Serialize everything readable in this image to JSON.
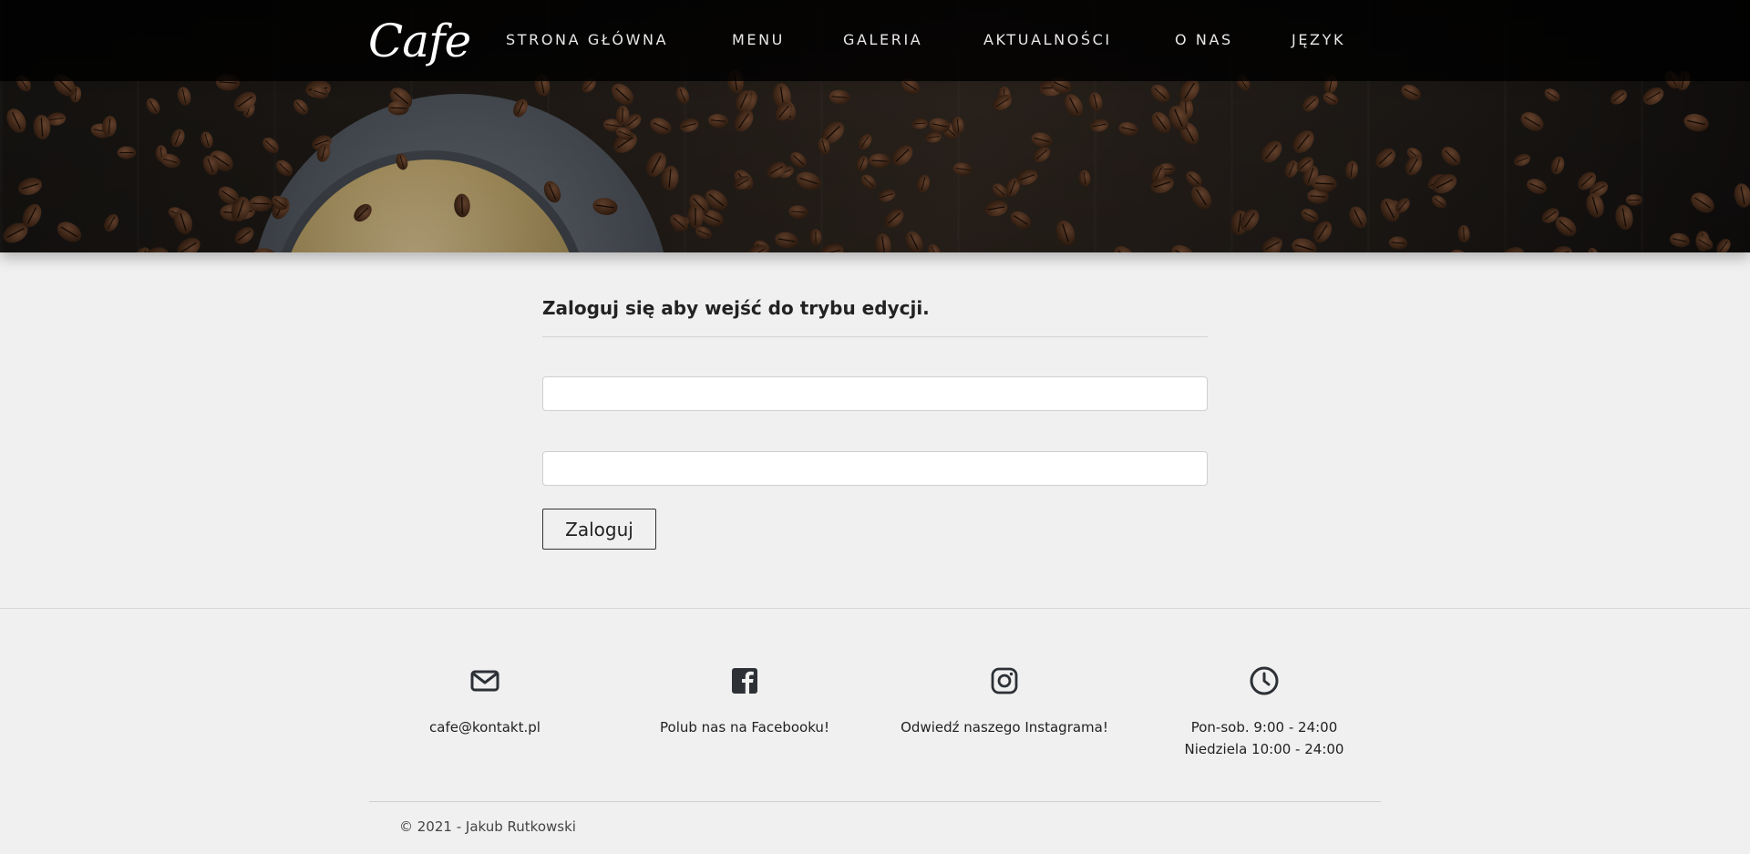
{
  "header": {
    "logo": "Cafe",
    "nav": [
      {
        "label": "STRONA GŁÓWNA"
      },
      {
        "label": "MENU"
      },
      {
        "label": "GALERIA"
      },
      {
        "label": "AKTUALNOŚCI"
      },
      {
        "label": "O NAS"
      },
      {
        "label": "JĘZYK"
      }
    ]
  },
  "login": {
    "title": "Zaloguj się aby wejść do trybu edycji.",
    "username_value": "",
    "password_value": "",
    "button_label": "Zaloguj"
  },
  "footer": {
    "contacts": [
      {
        "icon": "envelope-icon",
        "text": "cafe@kontakt.pl"
      },
      {
        "icon": "facebook-icon",
        "text": "Polub nas na Facebooku!"
      },
      {
        "icon": "instagram-icon",
        "text": "Odwiedź naszego Instagrama!"
      },
      {
        "icon": "clock-icon",
        "text": "Pon-sob. 9:00 - 24:00",
        "text2": "Niedziela 10:00 - 24:00"
      }
    ],
    "copyright": "© 2021 - Jakub Rutkowski"
  },
  "colors": {
    "page_background": "#f0f0f0",
    "navbar_background": "#0b0b0b",
    "icon_color": "#2d3136"
  }
}
